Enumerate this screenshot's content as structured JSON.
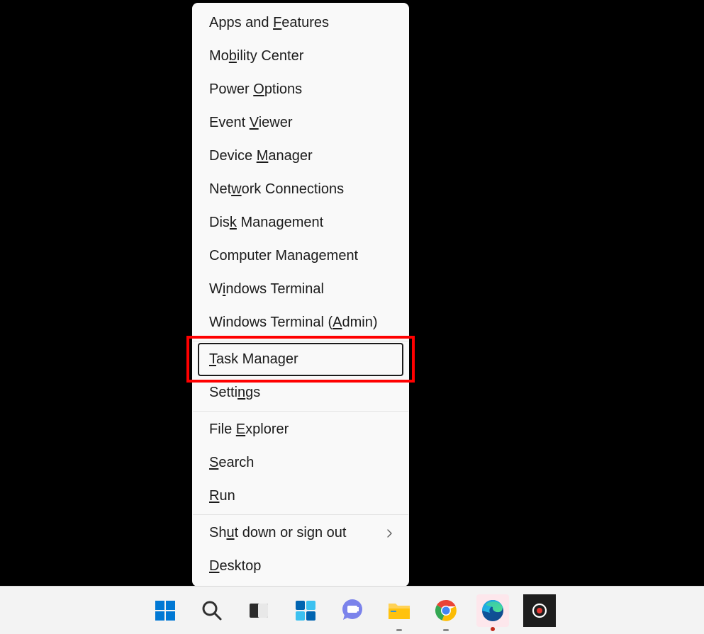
{
  "menu": {
    "items": [
      {
        "pre": "Apps and ",
        "u": "F",
        "post": "eatures"
      },
      {
        "pre": "Mo",
        "u": "b",
        "post": "ility Center"
      },
      {
        "pre": "Power ",
        "u": "O",
        "post": "ptions"
      },
      {
        "pre": "Event ",
        "u": "V",
        "post": "iewer"
      },
      {
        "pre": "Device ",
        "u": "M",
        "post": "anager"
      },
      {
        "pre": "Net",
        "u": "w",
        "post": "ork Connections"
      },
      {
        "pre": "Dis",
        "u": "k",
        "post": " Management"
      },
      {
        "pre": "Computer Mana",
        "u": "g",
        "post": "ement"
      },
      {
        "pre": "W",
        "u": "i",
        "post": "ndows Terminal"
      },
      {
        "pre": "Windows Terminal (",
        "u": "A",
        "post": "dmin)"
      },
      {
        "pre": "",
        "u": "T",
        "post": "ask Manager"
      },
      {
        "pre": "Setti",
        "u": "n",
        "post": "gs"
      },
      {
        "pre": "File ",
        "u": "E",
        "post": "xplorer"
      },
      {
        "pre": "",
        "u": "S",
        "post": "earch"
      },
      {
        "pre": "",
        "u": "R",
        "post": "un"
      },
      {
        "pre": "Sh",
        "u": "u",
        "post": "t down or sign out"
      },
      {
        "pre": "",
        "u": "D",
        "post": "esktop"
      }
    ]
  },
  "taskbar": {
    "items": [
      {
        "name": "start",
        "label": "Start"
      },
      {
        "name": "search",
        "label": "Search"
      },
      {
        "name": "task-view",
        "label": "Task View"
      },
      {
        "name": "widgets",
        "label": "Widgets"
      },
      {
        "name": "chat",
        "label": "Chat"
      },
      {
        "name": "file-explorer",
        "label": "File Explorer"
      },
      {
        "name": "chrome",
        "label": "Google Chrome"
      },
      {
        "name": "edge",
        "label": "Microsoft Edge"
      },
      {
        "name": "screenpresso",
        "label": "Screenpresso"
      }
    ]
  }
}
